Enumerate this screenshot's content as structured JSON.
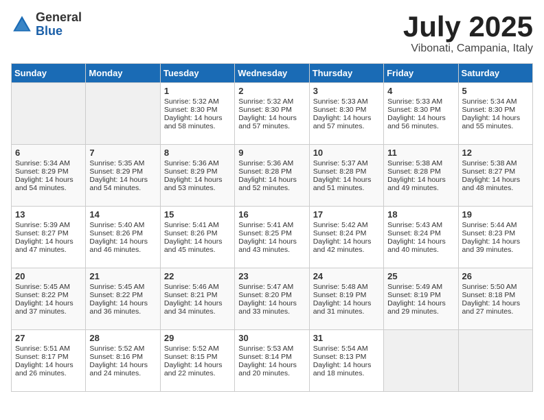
{
  "header": {
    "logo_general": "General",
    "logo_blue": "Blue",
    "month_title": "July 2025",
    "location": "Vibonati, Campania, Italy"
  },
  "days_of_week": [
    "Sunday",
    "Monday",
    "Tuesday",
    "Wednesday",
    "Thursday",
    "Friday",
    "Saturday"
  ],
  "weeks": [
    [
      {
        "day": "",
        "empty": true
      },
      {
        "day": "",
        "empty": true
      },
      {
        "day": "1",
        "sunrise": "Sunrise: 5:32 AM",
        "sunset": "Sunset: 8:30 PM",
        "daylight": "Daylight: 14 hours and 58 minutes."
      },
      {
        "day": "2",
        "sunrise": "Sunrise: 5:32 AM",
        "sunset": "Sunset: 8:30 PM",
        "daylight": "Daylight: 14 hours and 57 minutes."
      },
      {
        "day": "3",
        "sunrise": "Sunrise: 5:33 AM",
        "sunset": "Sunset: 8:30 PM",
        "daylight": "Daylight: 14 hours and 57 minutes."
      },
      {
        "day": "4",
        "sunrise": "Sunrise: 5:33 AM",
        "sunset": "Sunset: 8:30 PM",
        "daylight": "Daylight: 14 hours and 56 minutes."
      },
      {
        "day": "5",
        "sunrise": "Sunrise: 5:34 AM",
        "sunset": "Sunset: 8:30 PM",
        "daylight": "Daylight: 14 hours and 55 minutes."
      }
    ],
    [
      {
        "day": "6",
        "sunrise": "Sunrise: 5:34 AM",
        "sunset": "Sunset: 8:29 PM",
        "daylight": "Daylight: 14 hours and 54 minutes."
      },
      {
        "day": "7",
        "sunrise": "Sunrise: 5:35 AM",
        "sunset": "Sunset: 8:29 PM",
        "daylight": "Daylight: 14 hours and 54 minutes."
      },
      {
        "day": "8",
        "sunrise": "Sunrise: 5:36 AM",
        "sunset": "Sunset: 8:29 PM",
        "daylight": "Daylight: 14 hours and 53 minutes."
      },
      {
        "day": "9",
        "sunrise": "Sunrise: 5:36 AM",
        "sunset": "Sunset: 8:28 PM",
        "daylight": "Daylight: 14 hours and 52 minutes."
      },
      {
        "day": "10",
        "sunrise": "Sunrise: 5:37 AM",
        "sunset": "Sunset: 8:28 PM",
        "daylight": "Daylight: 14 hours and 51 minutes."
      },
      {
        "day": "11",
        "sunrise": "Sunrise: 5:38 AM",
        "sunset": "Sunset: 8:28 PM",
        "daylight": "Daylight: 14 hours and 49 minutes."
      },
      {
        "day": "12",
        "sunrise": "Sunrise: 5:38 AM",
        "sunset": "Sunset: 8:27 PM",
        "daylight": "Daylight: 14 hours and 48 minutes."
      }
    ],
    [
      {
        "day": "13",
        "sunrise": "Sunrise: 5:39 AM",
        "sunset": "Sunset: 8:27 PM",
        "daylight": "Daylight: 14 hours and 47 minutes."
      },
      {
        "day": "14",
        "sunrise": "Sunrise: 5:40 AM",
        "sunset": "Sunset: 8:26 PM",
        "daylight": "Daylight: 14 hours and 46 minutes."
      },
      {
        "day": "15",
        "sunrise": "Sunrise: 5:41 AM",
        "sunset": "Sunset: 8:26 PM",
        "daylight": "Daylight: 14 hours and 45 minutes."
      },
      {
        "day": "16",
        "sunrise": "Sunrise: 5:41 AM",
        "sunset": "Sunset: 8:25 PM",
        "daylight": "Daylight: 14 hours and 43 minutes."
      },
      {
        "day": "17",
        "sunrise": "Sunrise: 5:42 AM",
        "sunset": "Sunset: 8:24 PM",
        "daylight": "Daylight: 14 hours and 42 minutes."
      },
      {
        "day": "18",
        "sunrise": "Sunrise: 5:43 AM",
        "sunset": "Sunset: 8:24 PM",
        "daylight": "Daylight: 14 hours and 40 minutes."
      },
      {
        "day": "19",
        "sunrise": "Sunrise: 5:44 AM",
        "sunset": "Sunset: 8:23 PM",
        "daylight": "Daylight: 14 hours and 39 minutes."
      }
    ],
    [
      {
        "day": "20",
        "sunrise": "Sunrise: 5:45 AM",
        "sunset": "Sunset: 8:22 PM",
        "daylight": "Daylight: 14 hours and 37 minutes."
      },
      {
        "day": "21",
        "sunrise": "Sunrise: 5:45 AM",
        "sunset": "Sunset: 8:22 PM",
        "daylight": "Daylight: 14 hours and 36 minutes."
      },
      {
        "day": "22",
        "sunrise": "Sunrise: 5:46 AM",
        "sunset": "Sunset: 8:21 PM",
        "daylight": "Daylight: 14 hours and 34 minutes."
      },
      {
        "day": "23",
        "sunrise": "Sunrise: 5:47 AM",
        "sunset": "Sunset: 8:20 PM",
        "daylight": "Daylight: 14 hours and 33 minutes."
      },
      {
        "day": "24",
        "sunrise": "Sunrise: 5:48 AM",
        "sunset": "Sunset: 8:19 PM",
        "daylight": "Daylight: 14 hours and 31 minutes."
      },
      {
        "day": "25",
        "sunrise": "Sunrise: 5:49 AM",
        "sunset": "Sunset: 8:19 PM",
        "daylight": "Daylight: 14 hours and 29 minutes."
      },
      {
        "day": "26",
        "sunrise": "Sunrise: 5:50 AM",
        "sunset": "Sunset: 8:18 PM",
        "daylight": "Daylight: 14 hours and 27 minutes."
      }
    ],
    [
      {
        "day": "27",
        "sunrise": "Sunrise: 5:51 AM",
        "sunset": "Sunset: 8:17 PM",
        "daylight": "Daylight: 14 hours and 26 minutes."
      },
      {
        "day": "28",
        "sunrise": "Sunrise: 5:52 AM",
        "sunset": "Sunset: 8:16 PM",
        "daylight": "Daylight: 14 hours and 24 minutes."
      },
      {
        "day": "29",
        "sunrise": "Sunrise: 5:52 AM",
        "sunset": "Sunset: 8:15 PM",
        "daylight": "Daylight: 14 hours and 22 minutes."
      },
      {
        "day": "30",
        "sunrise": "Sunrise: 5:53 AM",
        "sunset": "Sunset: 8:14 PM",
        "daylight": "Daylight: 14 hours and 20 minutes."
      },
      {
        "day": "31",
        "sunrise": "Sunrise: 5:54 AM",
        "sunset": "Sunset: 8:13 PM",
        "daylight": "Daylight: 14 hours and 18 minutes."
      },
      {
        "day": "",
        "empty": true
      },
      {
        "day": "",
        "empty": true
      }
    ]
  ]
}
